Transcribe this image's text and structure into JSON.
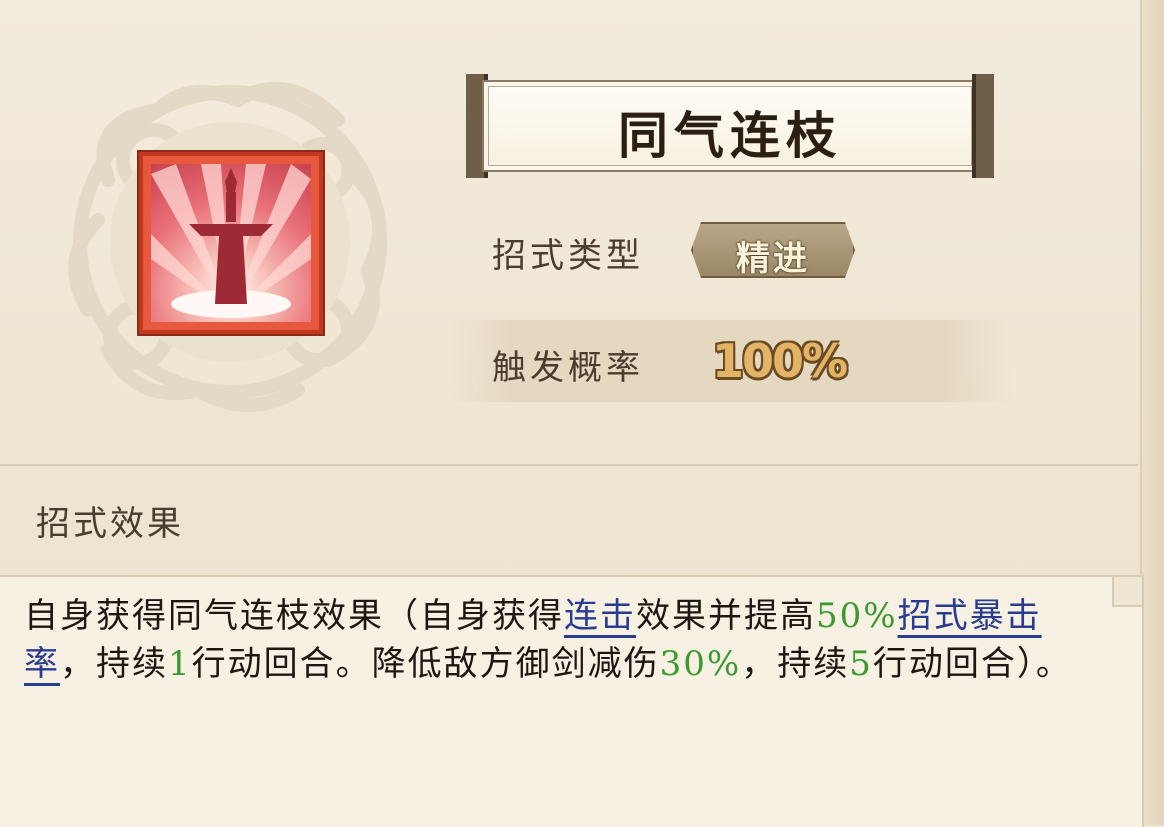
{
  "skill": {
    "name": "同气连枝",
    "icon": "sword-icon",
    "type_label": "招式类型",
    "type_value": "精进",
    "rate_label": "触发概率",
    "rate_value": "100%"
  },
  "effect": {
    "section_label": "招式效果",
    "segments": [
      {
        "text": "自身获得同气连枝效果（自身获得",
        "style": "plain"
      },
      {
        "text": "连击",
        "style": "keyword"
      },
      {
        "text": "效果并提高",
        "style": "plain"
      },
      {
        "text": "50%",
        "style": "number"
      },
      {
        "text": "招式暴击率",
        "style": "keyword"
      },
      {
        "text": "，持续",
        "style": "plain"
      },
      {
        "text": "1",
        "style": "number"
      },
      {
        "text": "行动回合。降低敌方御剑减伤",
        "style": "plain"
      },
      {
        "text": "30%",
        "style": "number"
      },
      {
        "text": "，持续",
        "style": "plain"
      },
      {
        "text": "5",
        "style": "number"
      },
      {
        "text": "行动回合）。",
        "style": "plain"
      }
    ]
  },
  "colors": {
    "keyword": "#2a3c8f",
    "number": "#3a9a30",
    "icon_border": "#c2381f",
    "badge": "#a8956f",
    "rate_value": "#e2b468"
  }
}
